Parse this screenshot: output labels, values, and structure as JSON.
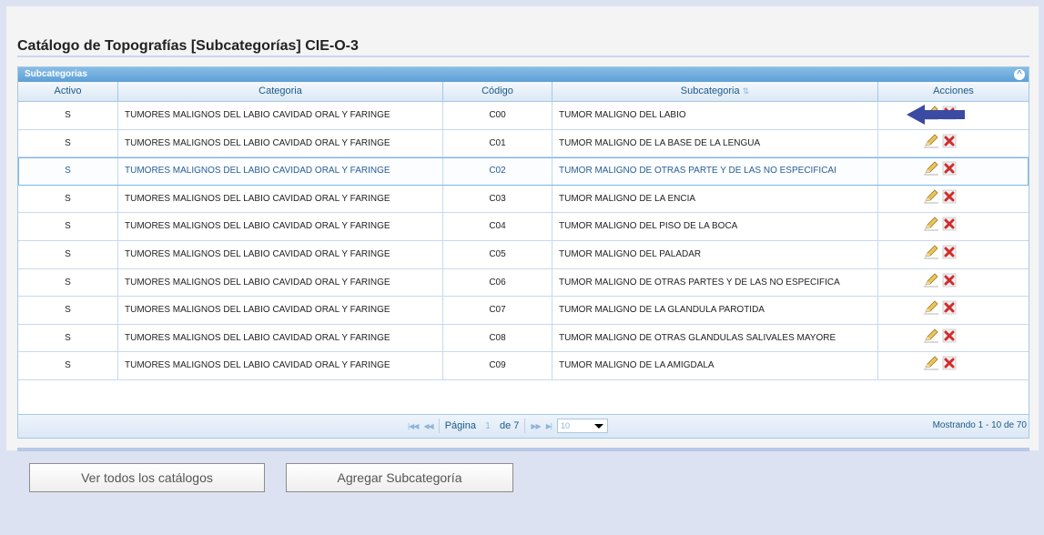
{
  "page": {
    "title": "Catálogo de Topografías [Subcategorías] CIE-O-3"
  },
  "grid": {
    "caption": "Subcategorias",
    "columns": [
      "Activo",
      "Categoria",
      "Código",
      "Subcategoria",
      "Acciones"
    ],
    "rows": [
      {
        "activo": "S",
        "categoria": "TUMORES MALIGNOS DEL LABIO CAVIDAD ORAL Y FARINGE",
        "codigo": "C00",
        "subcategoria": "TUMOR MALIGNO DEL LABIO"
      },
      {
        "activo": "S",
        "categoria": "TUMORES MALIGNOS DEL LABIO CAVIDAD ORAL Y FARINGE",
        "codigo": "C01",
        "subcategoria": "TUMOR MALIGNO DE LA BASE DE LA LENGUA"
      },
      {
        "activo": "S",
        "categoria": "TUMORES MALIGNOS DEL LABIO CAVIDAD ORAL Y FARINGE",
        "codigo": "C02",
        "subcategoria": "TUMOR MALIGNO DE OTRAS PARTE Y DE LAS NO ESPECIFICAI"
      },
      {
        "activo": "S",
        "categoria": "TUMORES MALIGNOS DEL LABIO CAVIDAD ORAL Y FARINGE",
        "codigo": "C03",
        "subcategoria": "TUMOR MALIGNO DE LA ENCIA"
      },
      {
        "activo": "S",
        "categoria": "TUMORES MALIGNOS DEL LABIO CAVIDAD ORAL Y FARINGE",
        "codigo": "C04",
        "subcategoria": "TUMOR MALIGNO DEL PISO DE LA BOCA"
      },
      {
        "activo": "S",
        "categoria": "TUMORES MALIGNOS DEL LABIO CAVIDAD ORAL Y FARINGE",
        "codigo": "C05",
        "subcategoria": "TUMOR MALIGNO DEL PALADAR"
      },
      {
        "activo": "S",
        "categoria": "TUMORES MALIGNOS DEL LABIO CAVIDAD ORAL Y FARINGE",
        "codigo": "C06",
        "subcategoria": "TUMOR MALIGNO DE OTRAS PARTES Y DE LAS NO ESPECIFICA"
      },
      {
        "activo": "S",
        "categoria": "TUMORES MALIGNOS DEL LABIO CAVIDAD ORAL Y FARINGE",
        "codigo": "C07",
        "subcategoria": "TUMOR MALIGNO DE LA GLANDULA PAROTIDA"
      },
      {
        "activo": "S",
        "categoria": "TUMORES MALIGNOS DEL LABIO CAVIDAD ORAL Y FARINGE",
        "codigo": "C08",
        "subcategoria": "TUMOR MALIGNO DE OTRAS GLANDULAS SALIVALES MAYORE"
      },
      {
        "activo": "S",
        "categoria": "TUMORES MALIGNOS DEL LABIO CAVIDAD ORAL Y FARINGE",
        "codigo": "C09",
        "subcategoria": "TUMOR MALIGNO DE LA AMIGDALA"
      }
    ],
    "highlighted_row": 2,
    "icons": {
      "edit": "pencil-edit-icon",
      "delete": "delete-x-icon",
      "sort": "sort-indicator-icon",
      "collapse": "collapse-circle-icon",
      "annotation": "left-arrow-icon"
    }
  },
  "pager": {
    "page_label": "Página",
    "page_value": "1",
    "of_label": "de 7",
    "rows_select_value": "10",
    "info": "Mostrando 1 - 10 de 70"
  },
  "buttons": {
    "view_all": "Ver todos los catálogos",
    "add": "Agregar Subcategoría"
  },
  "colors": {
    "background": "#dde2f3",
    "grid_header": "#5d9fd6",
    "header_text": "#1d5987",
    "arrow": "#3b4aa3"
  }
}
